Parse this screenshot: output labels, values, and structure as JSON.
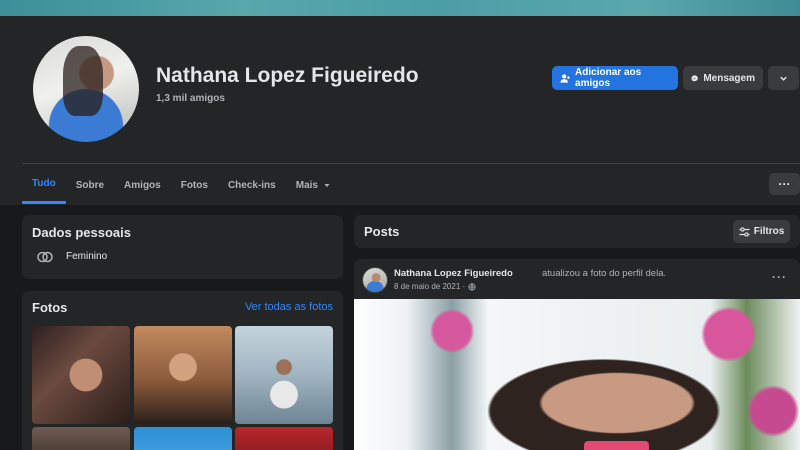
{
  "profile": {
    "name": "Nathana Lopez Figueiredo",
    "friends": "1,3 mil amigos"
  },
  "actions": {
    "add_friend": "Adicionar aos amigos",
    "message": "Mensagem",
    "more_icon": "chevron-down-icon"
  },
  "tabs": [
    {
      "label": "Tudo",
      "active": true
    },
    {
      "label": "Sobre"
    },
    {
      "label": "Amigos"
    },
    {
      "label": "Fotos"
    },
    {
      "label": "Check-ins"
    },
    {
      "label": "Mais"
    }
  ],
  "personal": {
    "title": "Dados pessoais",
    "gender": "Feminino"
  },
  "photos": {
    "title": "Fotos",
    "see_all": "Ver todas as fotos"
  },
  "posts": {
    "title": "Posts",
    "filters": "Filtros"
  },
  "post": {
    "author": "Nathana Lopez Figueiredo",
    "action": "atualizou a foto do perfil dela.",
    "date": "8 de maio de 2021 ·"
  },
  "colors": {
    "accent": "#2374e1",
    "link": "#2d88ff",
    "background": "#18191a",
    "card": "#242526"
  }
}
